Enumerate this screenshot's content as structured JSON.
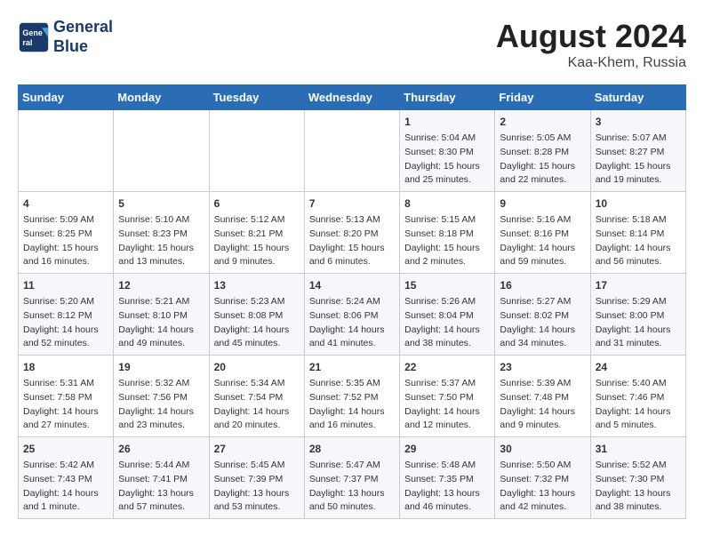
{
  "header": {
    "logo_line1": "General",
    "logo_line2": "Blue",
    "month_year": "August 2024",
    "location": "Kaa-Khem, Russia"
  },
  "weekdays": [
    "Sunday",
    "Monday",
    "Tuesday",
    "Wednesday",
    "Thursday",
    "Friday",
    "Saturday"
  ],
  "weeks": [
    [
      {
        "day": "",
        "info": ""
      },
      {
        "day": "",
        "info": ""
      },
      {
        "day": "",
        "info": ""
      },
      {
        "day": "",
        "info": ""
      },
      {
        "day": "1",
        "info": "Sunrise: 5:04 AM\nSunset: 8:30 PM\nDaylight: 15 hours\nand 25 minutes."
      },
      {
        "day": "2",
        "info": "Sunrise: 5:05 AM\nSunset: 8:28 PM\nDaylight: 15 hours\nand 22 minutes."
      },
      {
        "day": "3",
        "info": "Sunrise: 5:07 AM\nSunset: 8:27 PM\nDaylight: 15 hours\nand 19 minutes."
      }
    ],
    [
      {
        "day": "4",
        "info": "Sunrise: 5:09 AM\nSunset: 8:25 PM\nDaylight: 15 hours\nand 16 minutes."
      },
      {
        "day": "5",
        "info": "Sunrise: 5:10 AM\nSunset: 8:23 PM\nDaylight: 15 hours\nand 13 minutes."
      },
      {
        "day": "6",
        "info": "Sunrise: 5:12 AM\nSunset: 8:21 PM\nDaylight: 15 hours\nand 9 minutes."
      },
      {
        "day": "7",
        "info": "Sunrise: 5:13 AM\nSunset: 8:20 PM\nDaylight: 15 hours\nand 6 minutes."
      },
      {
        "day": "8",
        "info": "Sunrise: 5:15 AM\nSunset: 8:18 PM\nDaylight: 15 hours\nand 2 minutes."
      },
      {
        "day": "9",
        "info": "Sunrise: 5:16 AM\nSunset: 8:16 PM\nDaylight: 14 hours\nand 59 minutes."
      },
      {
        "day": "10",
        "info": "Sunrise: 5:18 AM\nSunset: 8:14 PM\nDaylight: 14 hours\nand 56 minutes."
      }
    ],
    [
      {
        "day": "11",
        "info": "Sunrise: 5:20 AM\nSunset: 8:12 PM\nDaylight: 14 hours\nand 52 minutes."
      },
      {
        "day": "12",
        "info": "Sunrise: 5:21 AM\nSunset: 8:10 PM\nDaylight: 14 hours\nand 49 minutes."
      },
      {
        "day": "13",
        "info": "Sunrise: 5:23 AM\nSunset: 8:08 PM\nDaylight: 14 hours\nand 45 minutes."
      },
      {
        "day": "14",
        "info": "Sunrise: 5:24 AM\nSunset: 8:06 PM\nDaylight: 14 hours\nand 41 minutes."
      },
      {
        "day": "15",
        "info": "Sunrise: 5:26 AM\nSunset: 8:04 PM\nDaylight: 14 hours\nand 38 minutes."
      },
      {
        "day": "16",
        "info": "Sunrise: 5:27 AM\nSunset: 8:02 PM\nDaylight: 14 hours\nand 34 minutes."
      },
      {
        "day": "17",
        "info": "Sunrise: 5:29 AM\nSunset: 8:00 PM\nDaylight: 14 hours\nand 31 minutes."
      }
    ],
    [
      {
        "day": "18",
        "info": "Sunrise: 5:31 AM\nSunset: 7:58 PM\nDaylight: 14 hours\nand 27 minutes."
      },
      {
        "day": "19",
        "info": "Sunrise: 5:32 AM\nSunset: 7:56 PM\nDaylight: 14 hours\nand 23 minutes."
      },
      {
        "day": "20",
        "info": "Sunrise: 5:34 AM\nSunset: 7:54 PM\nDaylight: 14 hours\nand 20 minutes."
      },
      {
        "day": "21",
        "info": "Sunrise: 5:35 AM\nSunset: 7:52 PM\nDaylight: 14 hours\nand 16 minutes."
      },
      {
        "day": "22",
        "info": "Sunrise: 5:37 AM\nSunset: 7:50 PM\nDaylight: 14 hours\nand 12 minutes."
      },
      {
        "day": "23",
        "info": "Sunrise: 5:39 AM\nSunset: 7:48 PM\nDaylight: 14 hours\nand 9 minutes."
      },
      {
        "day": "24",
        "info": "Sunrise: 5:40 AM\nSunset: 7:46 PM\nDaylight: 14 hours\nand 5 minutes."
      }
    ],
    [
      {
        "day": "25",
        "info": "Sunrise: 5:42 AM\nSunset: 7:43 PM\nDaylight: 14 hours\nand 1 minute."
      },
      {
        "day": "26",
        "info": "Sunrise: 5:44 AM\nSunset: 7:41 PM\nDaylight: 13 hours\nand 57 minutes."
      },
      {
        "day": "27",
        "info": "Sunrise: 5:45 AM\nSunset: 7:39 PM\nDaylight: 13 hours\nand 53 minutes."
      },
      {
        "day": "28",
        "info": "Sunrise: 5:47 AM\nSunset: 7:37 PM\nDaylight: 13 hours\nand 50 minutes."
      },
      {
        "day": "29",
        "info": "Sunrise: 5:48 AM\nSunset: 7:35 PM\nDaylight: 13 hours\nand 46 minutes."
      },
      {
        "day": "30",
        "info": "Sunrise: 5:50 AM\nSunset: 7:32 PM\nDaylight: 13 hours\nand 42 minutes."
      },
      {
        "day": "31",
        "info": "Sunrise: 5:52 AM\nSunset: 7:30 PM\nDaylight: 13 hours\nand 38 minutes."
      }
    ]
  ]
}
